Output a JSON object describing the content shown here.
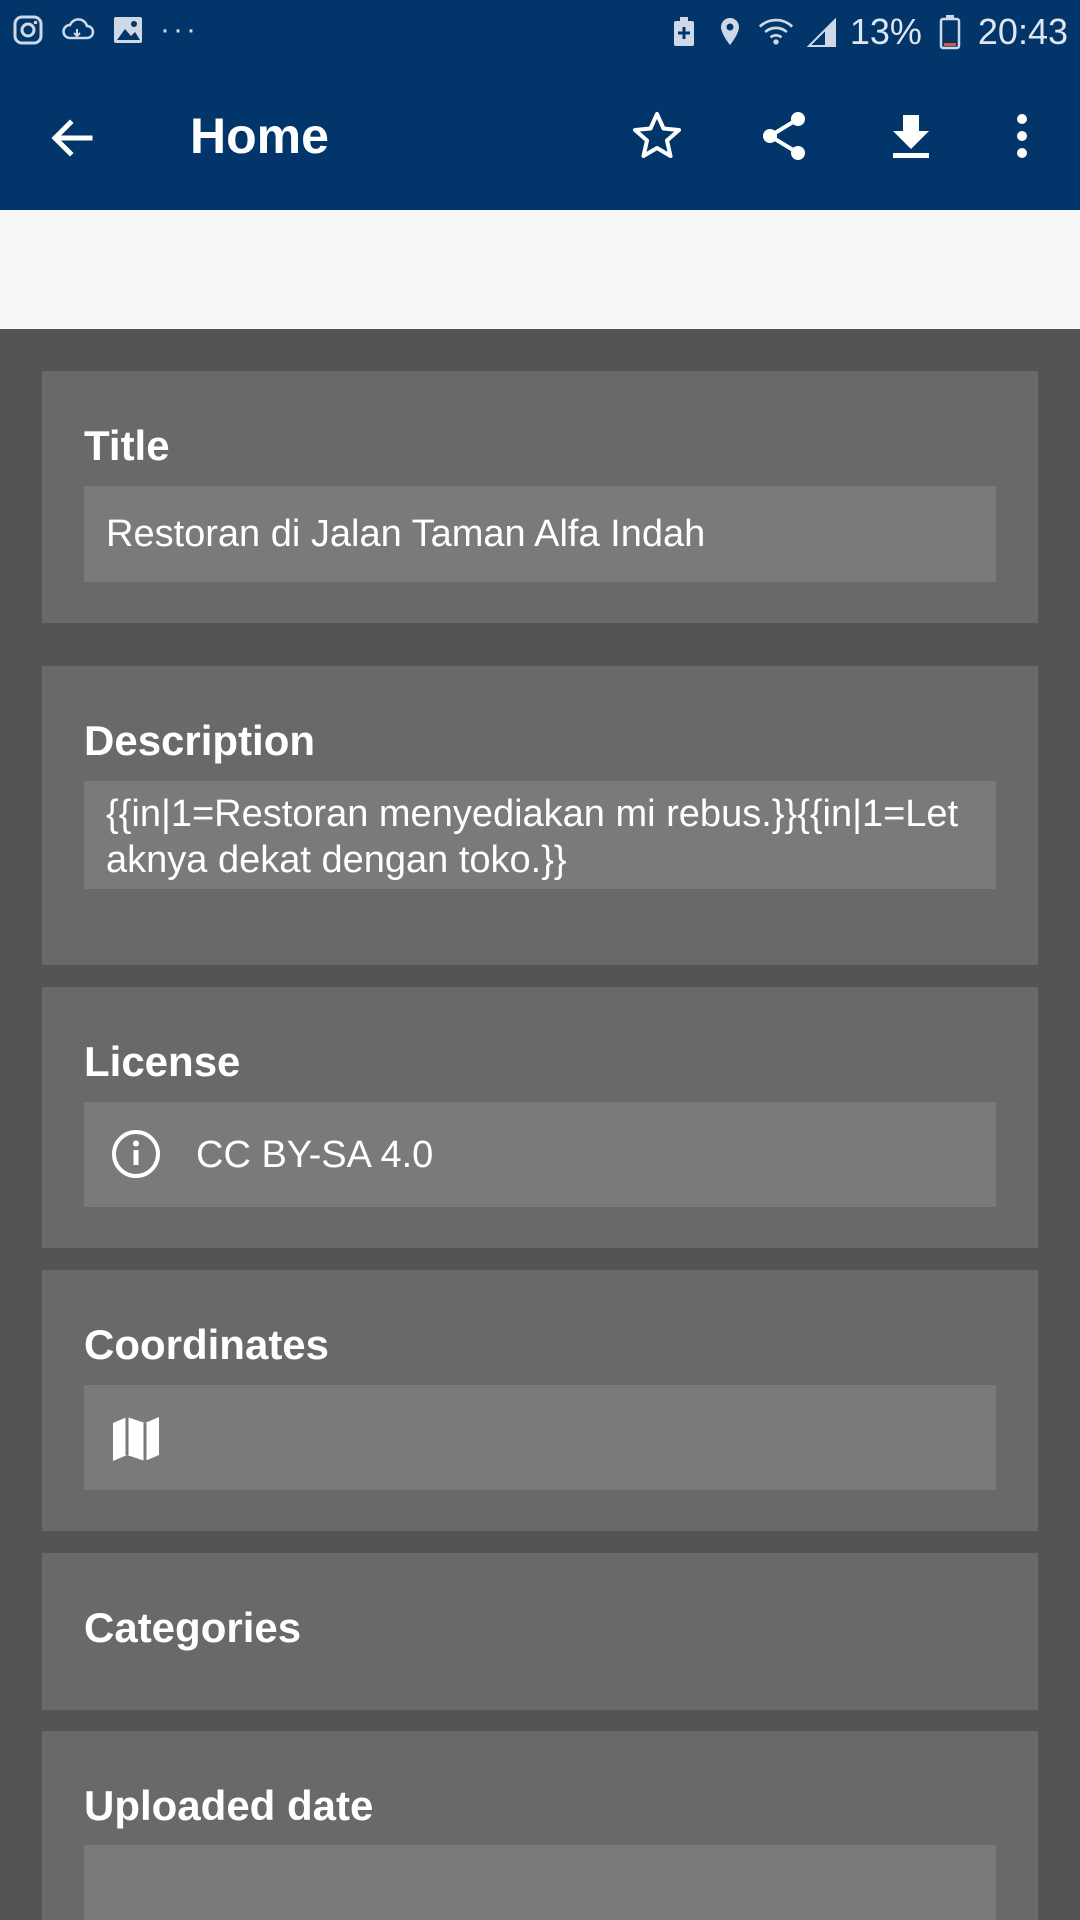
{
  "status_bar": {
    "battery": "13%",
    "time": "20:43",
    "left_icons": [
      "instagram-icon",
      "cloud-icon",
      "image-icon"
    ],
    "overflow": "···"
  },
  "app_bar": {
    "title": "Home",
    "actions": [
      "star-icon",
      "share-icon",
      "download-icon",
      "more-icon"
    ]
  },
  "details": {
    "title": {
      "label": "Title",
      "value": "Restoran di Jalan Taman Alfa Indah"
    },
    "description": {
      "label": "Description",
      "value": "{{in|1=Restoran menyediakan mi rebus.}}{{in|1=Letaknya dekat dengan toko.}}"
    },
    "license": {
      "label": "License",
      "value": "CC BY-SA 4.0",
      "icon": "info-icon"
    },
    "coordinates": {
      "label": "Coordinates",
      "value": "",
      "icon": "map-icon"
    },
    "categories": {
      "label": "Categories"
    },
    "uploaded_date": {
      "label": "Uploaded date",
      "value": ""
    }
  },
  "colors": {
    "primary": "#023569",
    "card": "#696969",
    "field": "#7a7a7a",
    "background": "#545454"
  }
}
